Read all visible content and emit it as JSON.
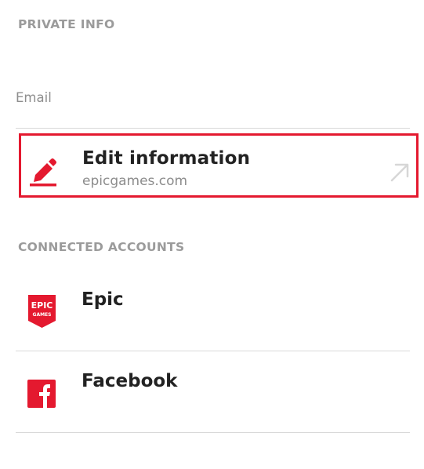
{
  "private_info": {
    "header": "PRIVATE INFO",
    "email_label": "Email",
    "edit": {
      "title": "Edit information",
      "subtitle": "epicgames.com"
    }
  },
  "connected_accounts": {
    "header": "CONNECTED ACCOUNTS",
    "accounts": [
      {
        "name": "Epic",
        "icon": "epic-games-logo-icon",
        "logo_text": [
          "EPIC",
          "GAMES"
        ]
      },
      {
        "name": "Facebook",
        "icon": "facebook-icon"
      }
    ]
  },
  "colors": {
    "accent": "#e4192f",
    "text_primary": "#222222",
    "text_muted": "#9b9b9b",
    "divider": "#d9d9d9"
  }
}
